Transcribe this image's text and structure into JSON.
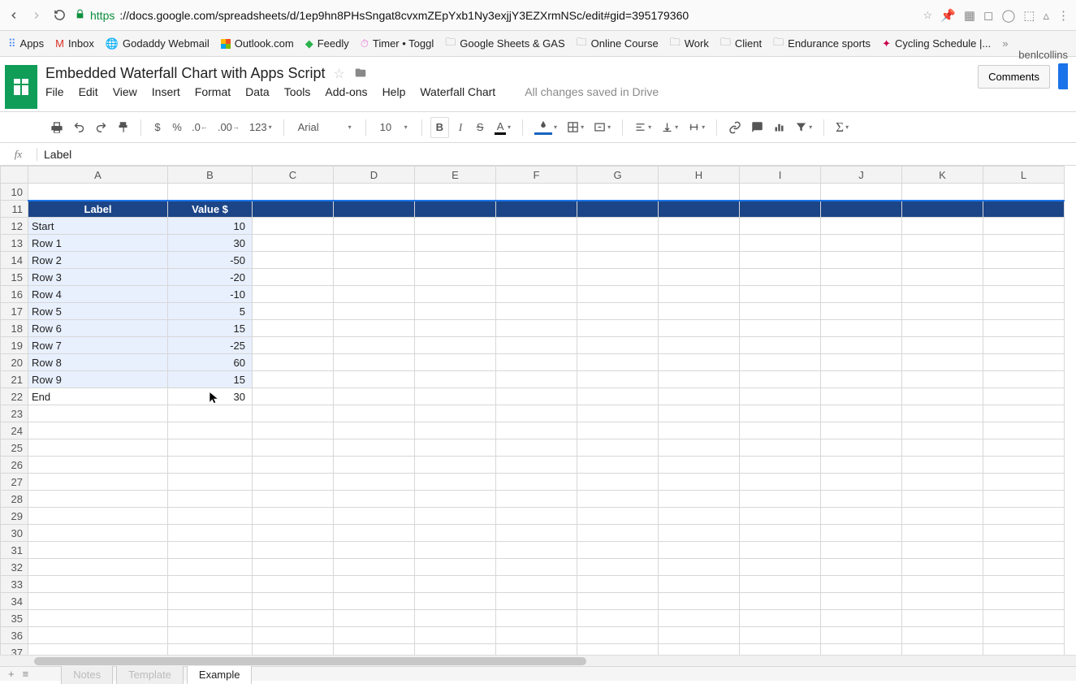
{
  "browser": {
    "url_scheme": "https",
    "url_display": "://docs.google.com/spreadsheets/d/1ep9hn8PHsSngat8cvxmZEpYxb1Ny3exjjY3EZXrmNSc/edit#gid=395179360"
  },
  "bookmarks": [
    {
      "icon": "grid",
      "label": "Apps"
    },
    {
      "icon": "gmail",
      "label": "Inbox"
    },
    {
      "icon": "globe",
      "label": "Godaddy Webmail"
    },
    {
      "icon": "outlook",
      "label": "Outlook.com"
    },
    {
      "icon": "feedly",
      "label": "Feedly"
    },
    {
      "icon": "timer",
      "label": "Timer • Toggl"
    },
    {
      "icon": "folder",
      "label": "Google Sheets & GAS"
    },
    {
      "icon": "folder",
      "label": "Online Course"
    },
    {
      "icon": "folder",
      "label": "Work"
    },
    {
      "icon": "folder",
      "label": "Client"
    },
    {
      "icon": "folder",
      "label": "Endurance sports"
    },
    {
      "icon": "nbc",
      "label": "Cycling Schedule |..."
    }
  ],
  "doc": {
    "title": "Embedded Waterfall Chart with Apps Script",
    "saved": "All changes saved in Drive",
    "account": "benlcollins",
    "comments_btn": "Comments"
  },
  "menus": [
    "File",
    "Edit",
    "View",
    "Insert",
    "Format",
    "Data",
    "Tools",
    "Add-ons",
    "Help",
    "Waterfall Chart"
  ],
  "toolbar": {
    "currency": "$",
    "percent": "%",
    "dec_dec": ".0",
    "dec_inc": ".00",
    "numfmt": "123",
    "font": "Arial",
    "size": "10",
    "bold": "B",
    "italic": "I",
    "strike": "S",
    "textcolor": "A"
  },
  "formula": {
    "fx": "fx",
    "value": "Label"
  },
  "columns": [
    "A",
    "B",
    "C",
    "D",
    "E",
    "F",
    "G",
    "H",
    "I",
    "J",
    "K",
    "L"
  ],
  "row_start": 10,
  "row_end": 37,
  "header_row": 11,
  "headers": {
    "A": "Label",
    "B": "Value $"
  },
  "rows": [
    {
      "r": 12,
      "A": "Start",
      "B": "10"
    },
    {
      "r": 13,
      "A": "Row 1",
      "B": "30"
    },
    {
      "r": 14,
      "A": "Row 2",
      "B": "-50"
    },
    {
      "r": 15,
      "A": "Row 3",
      "B": "-20"
    },
    {
      "r": 16,
      "A": "Row 4",
      "B": "-10"
    },
    {
      "r": 17,
      "A": "Row 5",
      "B": "5"
    },
    {
      "r": 18,
      "A": "Row 6",
      "B": "15"
    },
    {
      "r": 19,
      "A": "Row 7",
      "B": "-25"
    },
    {
      "r": 20,
      "A": "Row 8",
      "B": "60"
    },
    {
      "r": 21,
      "A": "Row 9",
      "B": "15"
    },
    {
      "r": 22,
      "A": "End",
      "B": "30"
    }
  ],
  "selection_last_row": 21,
  "chart_data": {
    "type": "table",
    "title": "Embedded Waterfall Chart data",
    "columns": [
      "Label",
      "Value $"
    ],
    "rows": [
      [
        "Start",
        10
      ],
      [
        "Row 1",
        30
      ],
      [
        "Row 2",
        -50
      ],
      [
        "Row 3",
        -20
      ],
      [
        "Row 4",
        -10
      ],
      [
        "Row 5",
        5
      ],
      [
        "Row 6",
        15
      ],
      [
        "Row 7",
        -25
      ],
      [
        "Row 8",
        60
      ],
      [
        "Row 9",
        15
      ],
      [
        "End",
        30
      ]
    ]
  },
  "tabs": [
    "Notes",
    "Template",
    "Example"
  ],
  "active_tab": 2
}
